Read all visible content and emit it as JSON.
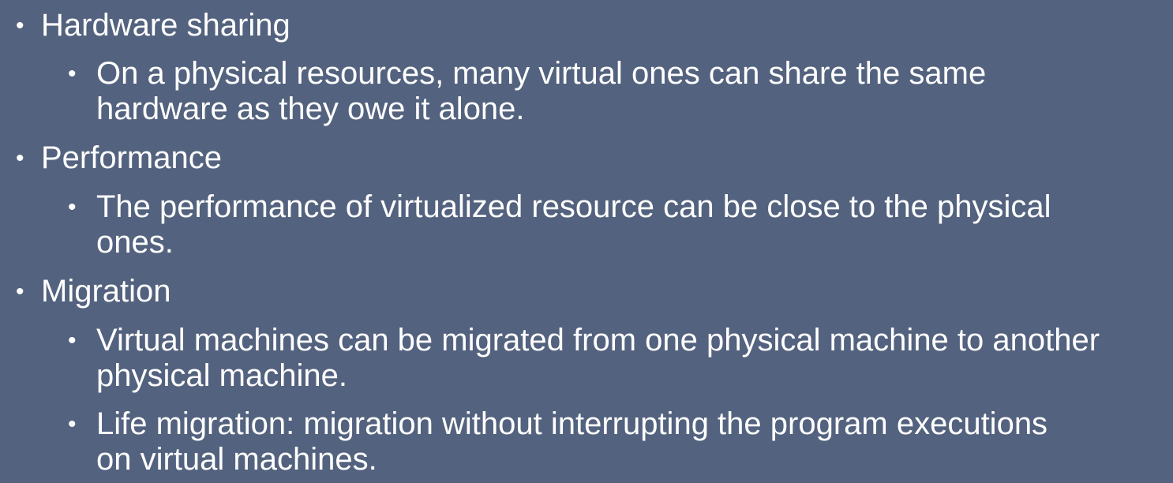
{
  "items": [
    {
      "text": "Hardware sharing",
      "children": [
        {
          "lines": [
            "On a physical resources, many virtual ones can share the same",
            "hardware as they owe it alone."
          ]
        }
      ]
    },
    {
      "text": "Performance",
      "children": [
        {
          "lines": [
            "The performance of virtualized resource can be close to the physical",
            "ones."
          ]
        }
      ]
    },
    {
      "text": "Migration",
      "children": [
        {
          "lines": [
            "Virtual machines can be migrated from one physical machine to another",
            "physical machine."
          ]
        },
        {
          "lines": [
            "Life migration: migration without interrupting the program executions",
            "on virtual machines."
          ]
        }
      ]
    }
  ],
  "bullet_char": "•"
}
